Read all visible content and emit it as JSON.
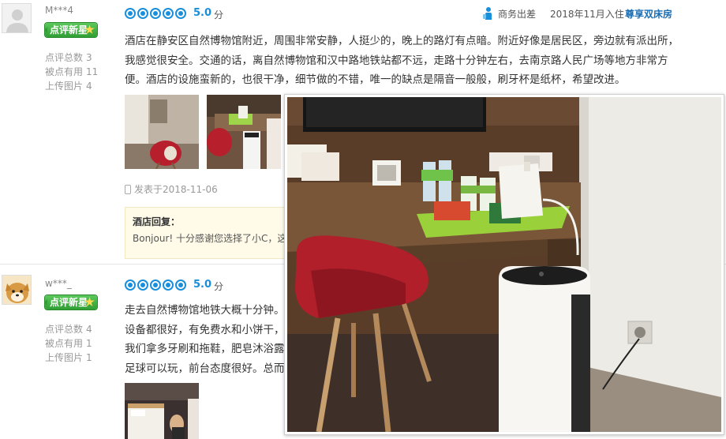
{
  "reviews": [
    {
      "username": "M***4",
      "badge": "点评新星",
      "stats": [
        {
          "label": "点评总数",
          "value": "3"
        },
        {
          "label": "被点有用",
          "value": "11"
        },
        {
          "label": "上传图片",
          "value": "4"
        }
      ],
      "score": "5.0",
      "score_unit": "分",
      "trip_type": "商务出差",
      "stay_date": "2018年11月入住",
      "room_type": "尊享双床房",
      "text": "酒店在静安区自然博物馆附近，周围非常安静，人挺少的，晚上的路灯有点暗。附近好像是居民区，旁边就有派出所，我感觉很安全。交通的话，离自然博物馆和汉中路地铁站都不远，走路十分钟左右，去南京路人民广场等地方非常方便。酒店的设施蛮新的，也很干净，细节做的不错，唯一的缺点是隔音一般般，刷牙杯是纸杯，希望改进。",
      "posted": "发表于2018-11-06",
      "reply_title": "酒店回复：",
      "reply_text": "Bonjour! 十分感谢您选择了小C，这里"
    },
    {
      "username": "w***_",
      "badge": "点评新星",
      "stats": [
        {
          "label": "点评总数",
          "value": "4"
        },
        {
          "label": "被点有用",
          "value": "1"
        },
        {
          "label": "上传图片",
          "value": "1"
        }
      ],
      "score": "5.0",
      "score_unit": "分",
      "text_lines": [
        "走去自然博物馆地铁大概十分钟。",
        "设备都很好，有免费水和小饼干，",
        "我们拿多牙刷和拖鞋，肥皂沐浴露",
        "足球可以玩，前台态度很好。总而"
      ]
    }
  ],
  "colors": {
    "accent": "#1a8fd9",
    "room_link": "#1a6db3",
    "badge_green": "#2f9e34",
    "reply_bg": "#fffbe8"
  },
  "icons": [
    "business-trip-icon",
    "phone-icon",
    "rating-dot-icon",
    "star-icon"
  ]
}
